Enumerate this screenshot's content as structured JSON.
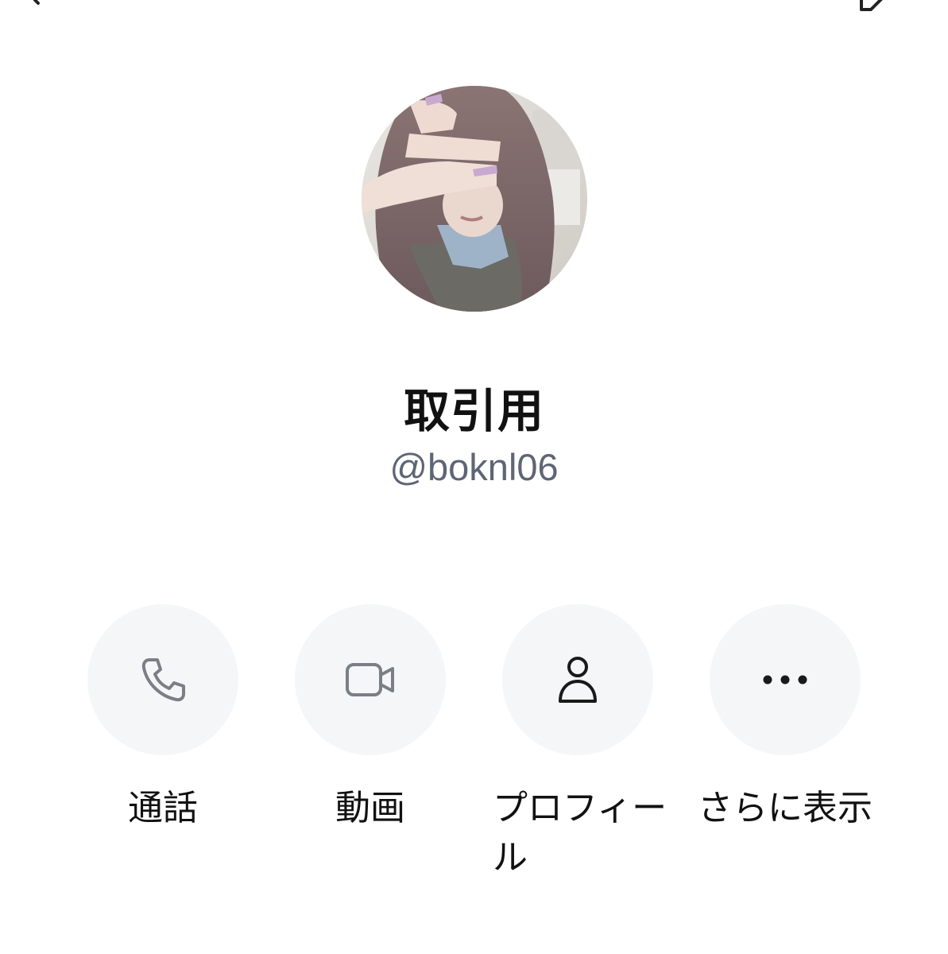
{
  "profile": {
    "display_name": "取引用",
    "username": "@boknl06"
  },
  "actions": [
    {
      "label": "通話",
      "icon": "phone-icon"
    },
    {
      "label": "動画",
      "icon": "video-camera-icon"
    },
    {
      "label": "プロフィール",
      "icon": "person-icon"
    },
    {
      "label": "さらに表示",
      "icon": "more-dots-icon"
    }
  ],
  "colors": {
    "background": "#ffffff",
    "action_circle": "#f5f6f7",
    "username_text": "#5e6573",
    "icon_gray": "#7a7f87"
  }
}
